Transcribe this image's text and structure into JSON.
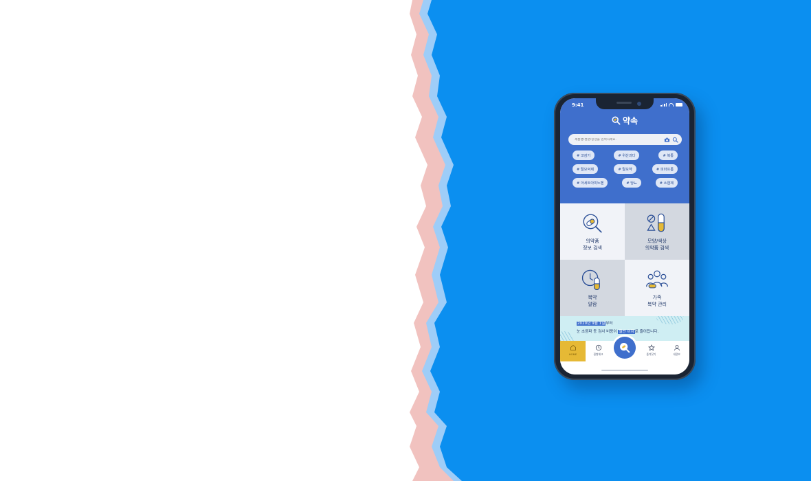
{
  "status": {
    "time": "9:41"
  },
  "app": {
    "name": "약속"
  },
  "search": {
    "placeholder": "제품명/성분/증상을 입력하세요."
  },
  "tags": [
    [
      "# 코감기",
      "# 위산과다",
      "# 복통"
    ],
    [
      "# 탈모억제",
      "# 탈모약",
      "# 피마프롬"
    ],
    [
      "# 아세트아미노펜",
      "# 당뇨",
      "# 소염제"
    ]
  ],
  "menu": [
    {
      "line1": "의약품",
      "line2": "정보 검색",
      "icon": "pill-magnifier-icon"
    },
    {
      "line1": "모양/색상",
      "line2": "의약품 검색",
      "icon": "pill-shapes-icon"
    },
    {
      "line1": "복약",
      "line2": "알람",
      "icon": "clock-pill-icon"
    },
    {
      "line1": "가족",
      "line2": "복약 관리",
      "icon": "family-icon"
    }
  ],
  "banner": {
    "highlight1": "2020년 9월 1일",
    "text1": "부터",
    "text2a": "눈 초음파 등 검사 비용이 ",
    "highlight2": "절반 이하",
    "text2b": "로 줄어듭니다."
  },
  "tabbar": {
    "home": "HOME",
    "check": "질병체크",
    "favorites": "즐겨찾기",
    "profile": "내정보"
  },
  "colors": {
    "brand_blue": "#3f6fcc",
    "accent_yellow": "#e6b935",
    "background_blue": "#0a8fef"
  }
}
